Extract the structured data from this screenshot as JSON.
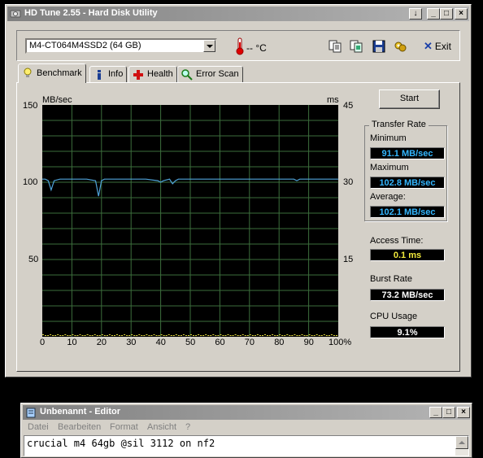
{
  "hdtune": {
    "title": "HD Tune 2.55 - Hard Disk Utility",
    "drive": "M4-CT064M4SSD2 (64 GB)",
    "temperature": "-- °C",
    "exit_label": "Exit",
    "tabs": [
      {
        "label": "Benchmark"
      },
      {
        "label": "Info"
      },
      {
        "label": "Health"
      },
      {
        "label": "Error Scan"
      }
    ],
    "start_label": "Start",
    "transfer_rate": {
      "legend": "Transfer Rate",
      "minimum_label": "Minimum",
      "minimum_value": "91.1 MB/sec",
      "maximum_label": "Maximum",
      "maximum_value": "102.8 MB/sec",
      "average_label": "Average:",
      "average_value": "102.1 MB/sec"
    },
    "access_time": {
      "label": "Access Time:",
      "value": "0.1 ms"
    },
    "burst_rate": {
      "label": "Burst Rate",
      "value": "73.2 MB/sec"
    },
    "cpu_usage": {
      "label": "CPU Usage",
      "value": "9.1%"
    },
    "colors": {
      "transfer_line": "#4fa3d9",
      "access_points": "#e8e040",
      "grid": "#3c6e3c",
      "plot_bg": "#000000"
    }
  },
  "chart_data": {
    "type": "line",
    "xlabel": "",
    "ylabel_left": "MB/sec",
    "ylabel_right": "ms",
    "x_ticks": [
      "0",
      "10",
      "20",
      "30",
      "40",
      "50",
      "60",
      "70",
      "80",
      "90",
      "100%"
    ],
    "y_left_ticks": [
      "150",
      "100",
      "50"
    ],
    "y_right_ticks": [
      "45",
      "30",
      "15"
    ],
    "ylim_left": [
      0,
      150
    ],
    "ylim_right": [
      0,
      45
    ],
    "xlim": [
      0,
      100
    ],
    "grid": true,
    "series": [
      {
        "color": "#4fa3d9",
        "x": [
          0,
          1,
          2,
          3,
          4,
          6,
          10,
          15,
          18,
          19,
          20,
          21,
          25,
          30,
          35,
          39,
          40,
          41,
          43,
          44,
          45,
          46,
          50,
          55,
          60,
          65,
          70,
          75,
          80,
          85,
          86,
          87,
          90,
          95,
          100
        ],
        "y": [
          102,
          102,
          101,
          95,
          101,
          102,
          102,
          102,
          101,
          91,
          101,
          102,
          102,
          102,
          102,
          101,
          100,
          101,
          102,
          99,
          101,
          102,
          102,
          102,
          102,
          102,
          102,
          102,
          102,
          102,
          101,
          102,
          102,
          102,
          102
        ]
      }
    ]
  },
  "editor": {
    "title": "Unbenannt - Editor",
    "menus": [
      "Datei",
      "Bearbeiten",
      "Format",
      "Ansicht",
      "?"
    ],
    "text": "crucial m4 64gb @sil 3112 on nf2"
  }
}
